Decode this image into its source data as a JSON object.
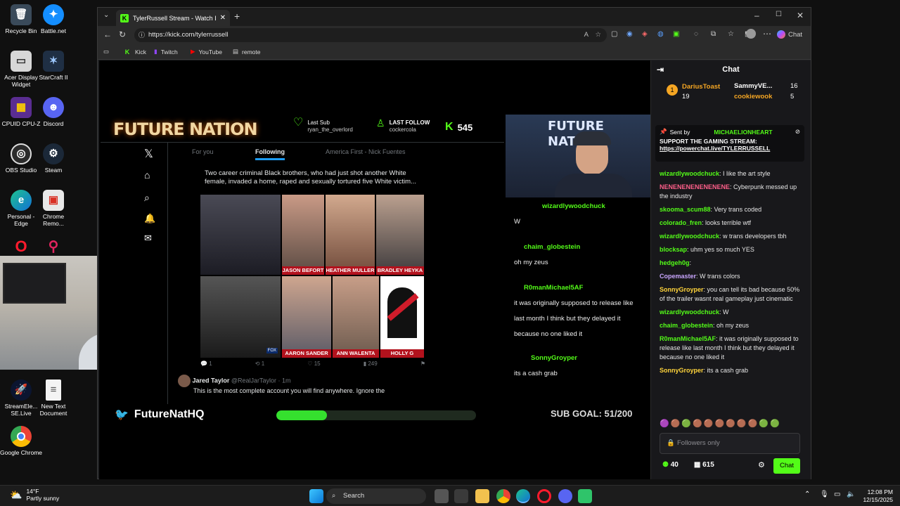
{
  "desktop": {
    "icons": [
      "Recycle Bin",
      "Battle.net",
      "Acer Display Widget",
      "StarCraft II",
      "CPUID CPU-Z",
      "Discord",
      "OBS Studio",
      "Steam",
      "Personal - Edge",
      "Chrome Remo...",
      "StreamEle... SE.Live",
      "New Text Document",
      "Google Chrome"
    ]
  },
  "browser": {
    "tab_title": "TylerRussell Stream - Watch L",
    "url": "https://kick.com/tylerrussell",
    "chat_button": "Chat",
    "bookmarks": [
      "Kick",
      "Twitch",
      "YouTube",
      "remote"
    ]
  },
  "stream": {
    "logo": "FUTURE NATION",
    "last_sub_label": "Last Sub",
    "last_sub_user": "ryan_the_overlord",
    "last_follow_label": "LAST FOLLOW",
    "last_follow_user": "cockercola",
    "follow_count": "545",
    "x_tabs": [
      "For you",
      "Following",
      "America First - Nick Fuentes"
    ],
    "post_text": "Two career criminal Black brothers, who had just shot another White female, invaded a home, raped and sexually tortured five White victim...",
    "photo_captions": [
      "JASON BEFORT",
      "HEATHER MULLER",
      "BRADLEY HEYKA",
      "AARON SANDER",
      "ANN WALENTA",
      "HOLLY G"
    ],
    "engagement": [
      "1",
      "1",
      "15",
      "249"
    ],
    "next_author": "Jared Taylor",
    "next_handle": "@RealJarTaylor · 1m",
    "next_text": "This is the most complete account you will find anywhere. Ignore the",
    "cam_chat": [
      {
        "user": "wizardlywoodchuck",
        "msg": "W"
      },
      {
        "user": "chaim_globestein",
        "msg": "oh my zeus"
      },
      {
        "user": "R0manMichael5AF",
        "msg": "it was originally supposed to release like last month I think but they delayed it because no one liked it"
      },
      {
        "user": "SonnyGroyper",
        "msg": "its a cash grab"
      }
    ],
    "twitter_handle": "FutureNatHQ",
    "sub_goal": "SUB GOAL: 51/200",
    "sub_goal_fraction": 0.255
  },
  "chat": {
    "title": "Chat",
    "leaderboard": [
      {
        "name": "DariusToast",
        "count": "19"
      },
      {
        "name": "SammyVE...",
        "count": "16"
      },
      {
        "name": "cookiewook",
        "count": "5"
      }
    ],
    "pinned_sender": "Sent by",
    "pinned_user": "MICHAELIONHEART",
    "pinned_text": "SUPPORT THE GAMING STREAM:",
    "pinned_link": "https://powerchat.live/TYLERRUSSELL",
    "messages": [
      {
        "user": "wizardlywoodchuck",
        "text": ": I like the art style",
        "color": "#53fc18"
      },
      {
        "user": "NENENENENENENENE",
        "text": ": Cyberpunk messed up the industry",
        "color": "#ff5f8a"
      },
      {
        "user": "skooma_scum88",
        "text": ": Very trans coded",
        "color": "#53fc18"
      },
      {
        "user": "colorado_fren",
        "text": ": looks terrible wtf",
        "color": "#53fc18"
      },
      {
        "user": "wizardlywoodchuck",
        "text": ": w trans developers tbh",
        "color": "#53fc18"
      },
      {
        "user": "blocksap",
        "text": ": uhm yes so much YES",
        "color": "#53fc18"
      },
      {
        "user": "hedgeh0g",
        "text": ":",
        "color": "#53fc18"
      },
      {
        "user": "Copemaster",
        "text": ": W trans colors",
        "color": "#c9a6ff"
      },
      {
        "user": "SonnyGroyper",
        "text": ": you can tell its bad because 50% of the trailer wasnt real gameplay just cinematic",
        "color": "#ffd43b"
      },
      {
        "user": "wizardlywoodchuck",
        "text": ": W",
        "color": "#53fc18"
      },
      {
        "user": "chaim_globestein",
        "text": ": oh my zeus",
        "color": "#53fc18"
      },
      {
        "user": "R0manMichael5AF",
        "text": ": it was originally supposed to release like last month I think but they delayed it because no one liked it",
        "color": "#53fc18"
      },
      {
        "user": "SonnyGroyper",
        "text": ": its a cash grab",
        "color": "#ffd43b"
      }
    ],
    "input_placeholder": "Followers only",
    "viewer_count": "40",
    "points": "615",
    "send_label": "Chat"
  },
  "taskbar": {
    "weather_temp": "14°F",
    "weather_desc": "Partly sunny",
    "search_label": "Search",
    "time": "12:08 PM",
    "date": "12/15/2025"
  }
}
